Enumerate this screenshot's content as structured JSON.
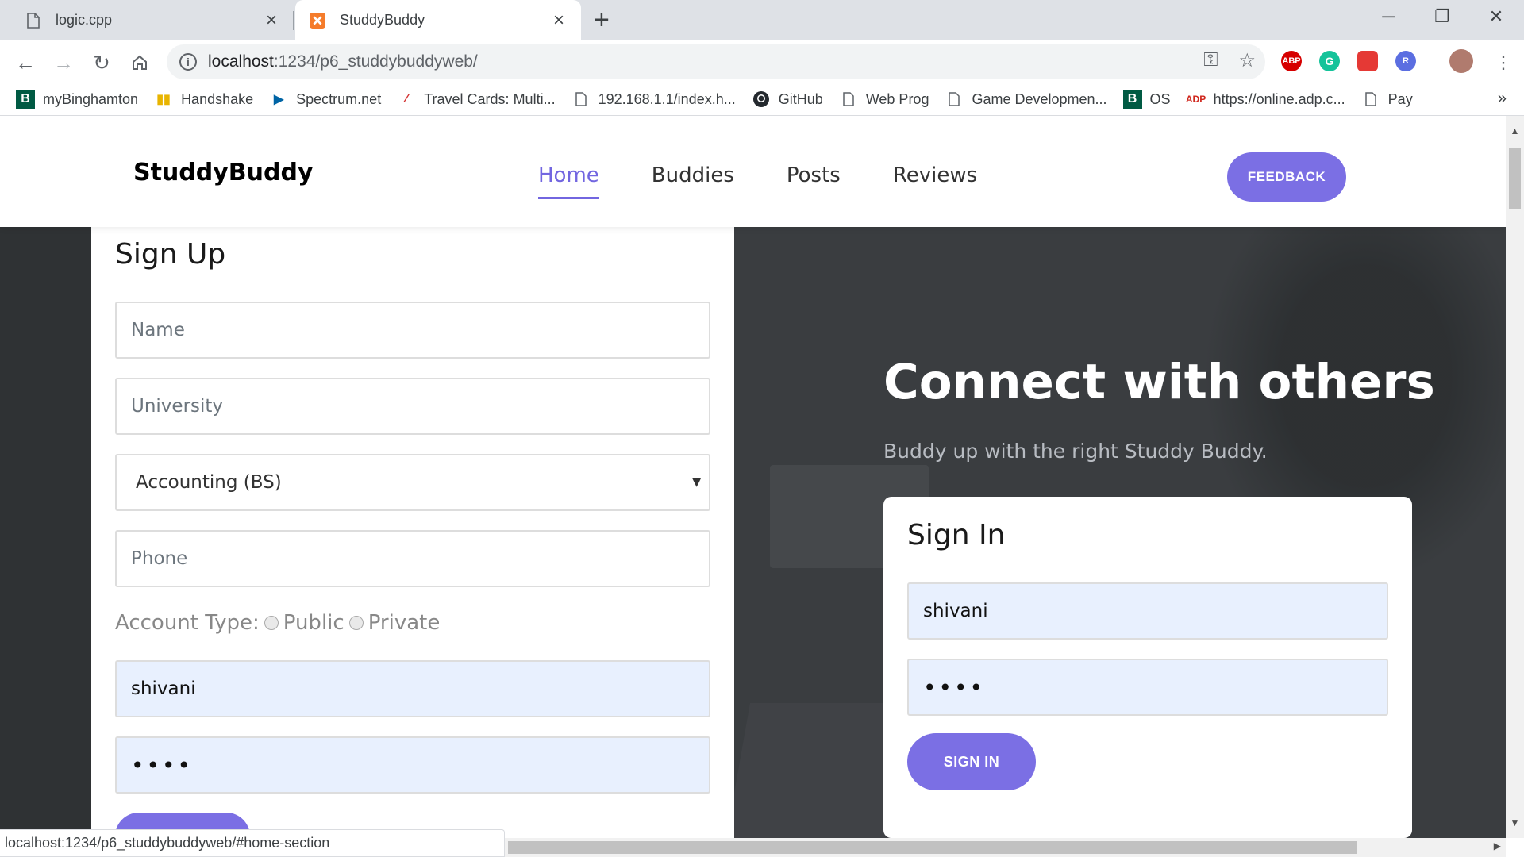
{
  "browser": {
    "tabs": [
      {
        "title": "logic.cpp",
        "icon": "file-icon"
      },
      {
        "title": "StuddyBuddy",
        "icon": "xampp-icon"
      }
    ],
    "url_host": "localhost",
    "url_path": ":1234/p6_studdybuddyweb/",
    "bookmarks": [
      {
        "label": "myBinghamton",
        "icon": "b-logo-icon"
      },
      {
        "label": "Handshake",
        "icon": "handshake-icon"
      },
      {
        "label": "Spectrum.net",
        "icon": "play-icon"
      },
      {
        "label": "Travel Cards: Multi...",
        "icon": "slash-icon"
      },
      {
        "label": "192.168.1.1/index.h...",
        "icon": "file-icon"
      },
      {
        "label": "GitHub",
        "icon": "github-icon"
      },
      {
        "label": "Web Prog",
        "icon": "file-icon"
      },
      {
        "label": "Game Developmen...",
        "icon": "file-icon"
      },
      {
        "label": "OS",
        "icon": "b-logo-icon"
      },
      {
        "label": "https://online.adp.c...",
        "icon": "adp-icon"
      },
      {
        "label": "Pay",
        "icon": "file-icon"
      }
    ],
    "bookmarks_more": "»",
    "status_url": "localhost:1234/p6_studdybuddyweb/#home-section",
    "extensions": [
      {
        "label": "ABP",
        "color": "#d60000"
      },
      {
        "label": "G",
        "color": "#15c39a"
      },
      {
        "label": "",
        "color": "#e53935"
      },
      {
        "label": "R",
        "color": "#5b6ee1"
      }
    ]
  },
  "site": {
    "brand": "StuddyBuddy",
    "nav": [
      "Home",
      "Buddies",
      "Posts",
      "Reviews"
    ],
    "active_nav": "Home",
    "feedback_label": "FEEDBACK",
    "accent_color": "#7b6fe4"
  },
  "signup": {
    "title": "Sign Up",
    "name_placeholder": "Name",
    "university_placeholder": "University",
    "major_selected": "Accounting (BS)",
    "phone_placeholder": "Phone",
    "account_type_label": "Account Type:",
    "account_options": [
      "Public",
      "Private"
    ],
    "username_value": "shivani",
    "password_mask": "••••"
  },
  "hero": {
    "title": "Connect with others",
    "subtitle": "Buddy up with the right Studdy Buddy."
  },
  "signin": {
    "title": "Sign In",
    "username_value": "shivani",
    "password_mask": "••••",
    "button_label": "SIGN IN"
  }
}
